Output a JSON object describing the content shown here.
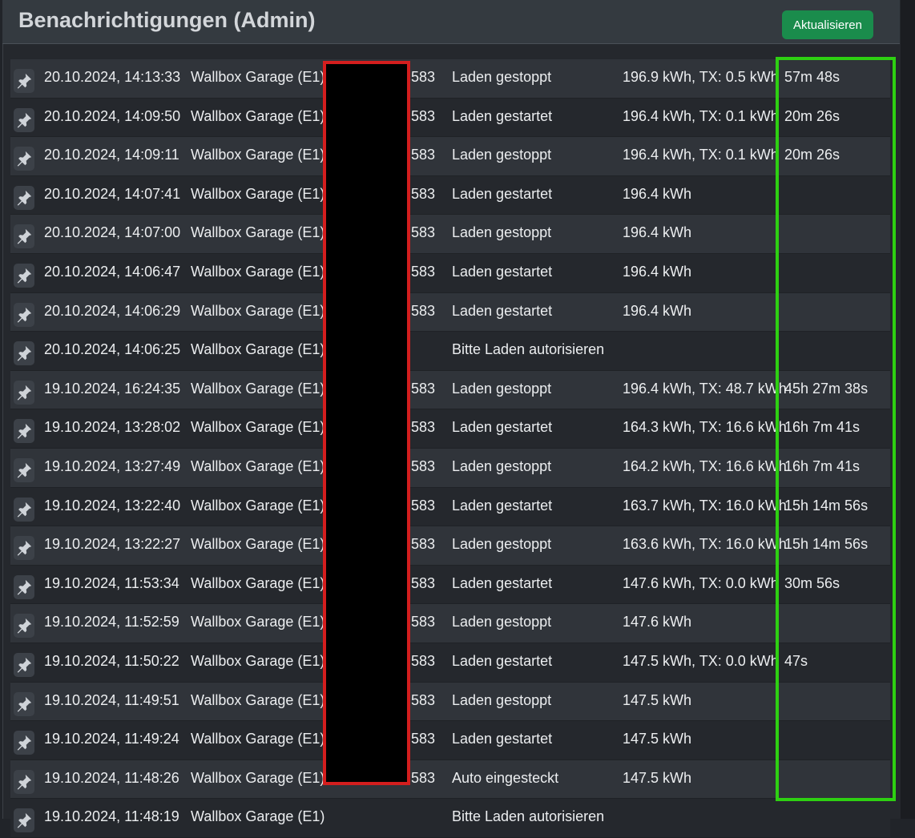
{
  "header": {
    "title": "Benachrichtigungen (Admin)",
    "refresh_label": "Aktualisieren"
  },
  "colors": {
    "redaction_border": "#d41e1e",
    "highlight_border": "#2ed012",
    "refresh_button": "#1a8c4c"
  },
  "icons": {
    "row_icon": "pin-icon"
  },
  "rows": [
    {
      "date": "20.10.2024, 14:13:33",
      "device": "Wallbox Garage (E1)",
      "id": "583",
      "event": "Laden gestoppt",
      "value": "196.9 kWh, TX: 0.5 kWh",
      "duration": "57m 48s"
    },
    {
      "date": "20.10.2024, 14:09:50",
      "device": "Wallbox Garage (E1)",
      "id": "583",
      "event": "Laden gestartet",
      "value": "196.4 kWh, TX: 0.1 kWh",
      "duration": "20m 26s"
    },
    {
      "date": "20.10.2024, 14:09:11",
      "device": "Wallbox Garage (E1)",
      "id": "583",
      "event": "Laden gestoppt",
      "value": "196.4 kWh, TX: 0.1 kWh",
      "duration": "20m 26s"
    },
    {
      "date": "20.10.2024, 14:07:41",
      "device": "Wallbox Garage (E1)",
      "id": "583",
      "event": "Laden gestartet",
      "value": "196.4 kWh",
      "duration": ""
    },
    {
      "date": "20.10.2024, 14:07:00",
      "device": "Wallbox Garage (E1)",
      "id": "583",
      "event": "Laden gestoppt",
      "value": "196.4 kWh",
      "duration": ""
    },
    {
      "date": "20.10.2024, 14:06:47",
      "device": "Wallbox Garage (E1)",
      "id": "583",
      "event": "Laden gestartet",
      "value": "196.4 kWh",
      "duration": ""
    },
    {
      "date": "20.10.2024, 14:06:29",
      "device": "Wallbox Garage (E1)",
      "id": "583",
      "event": "Laden gestartet",
      "value": "196.4 kWh",
      "duration": ""
    },
    {
      "date": "20.10.2024, 14:06:25",
      "device": "Wallbox Garage (E1)",
      "id": "",
      "event": "Bitte Laden autorisieren",
      "value": "",
      "duration": ""
    },
    {
      "date": "19.10.2024, 16:24:35",
      "device": "Wallbox Garage (E1)",
      "id": "583",
      "event": "Laden gestoppt",
      "value": "196.4 kWh, TX: 48.7 kWh",
      "duration": "45h 27m 38s"
    },
    {
      "date": "19.10.2024, 13:28:02",
      "device": "Wallbox Garage (E1)",
      "id": "583",
      "event": "Laden gestartet",
      "value": "164.3 kWh, TX: 16.6 kWh",
      "duration": "16h 7m 41s"
    },
    {
      "date": "19.10.2024, 13:27:49",
      "device": "Wallbox Garage (E1)",
      "id": "583",
      "event": "Laden gestoppt",
      "value": "164.2 kWh, TX: 16.6 kWh",
      "duration": "16h 7m 41s"
    },
    {
      "date": "19.10.2024, 13:22:40",
      "device": "Wallbox Garage (E1)",
      "id": "583",
      "event": "Laden gestartet",
      "value": "163.7 kWh, TX: 16.0 kWh",
      "duration": "15h 14m 56s"
    },
    {
      "date": "19.10.2024, 13:22:27",
      "device": "Wallbox Garage (E1)",
      "id": "583",
      "event": "Laden gestoppt",
      "value": "163.6 kWh, TX: 16.0 kWh",
      "duration": "15h 14m 56s"
    },
    {
      "date": "19.10.2024, 11:53:34",
      "device": "Wallbox Garage (E1)",
      "id": "583",
      "event": "Laden gestartet",
      "value": "147.6 kWh, TX: 0.0 kWh",
      "duration": "30m 56s"
    },
    {
      "date": "19.10.2024, 11:52:59",
      "device": "Wallbox Garage (E1)",
      "id": "583",
      "event": "Laden gestoppt",
      "value": "147.6 kWh",
      "duration": ""
    },
    {
      "date": "19.10.2024, 11:50:22",
      "device": "Wallbox Garage (E1)",
      "id": "583",
      "event": "Laden gestartet",
      "value": "147.5 kWh, TX: 0.0 kWh",
      "duration": "47s"
    },
    {
      "date": "19.10.2024, 11:49:51",
      "device": "Wallbox Garage (E1)",
      "id": "583",
      "event": "Laden gestoppt",
      "value": "147.5 kWh",
      "duration": ""
    },
    {
      "date": "19.10.2024, 11:49:24",
      "device": "Wallbox Garage (E1)",
      "id": "583",
      "event": "Laden gestartet",
      "value": "147.5 kWh",
      "duration": ""
    },
    {
      "date": "19.10.2024, 11:48:26",
      "device": "Wallbox Garage (E1)",
      "id": "583",
      "event": "Auto eingesteckt",
      "value": "147.5 kWh",
      "duration": ""
    },
    {
      "date": "19.10.2024, 11:48:19",
      "device": "Wallbox Garage (E1)",
      "id": "",
      "event": "Bitte Laden autorisieren",
      "value": "",
      "duration": ""
    }
  ]
}
